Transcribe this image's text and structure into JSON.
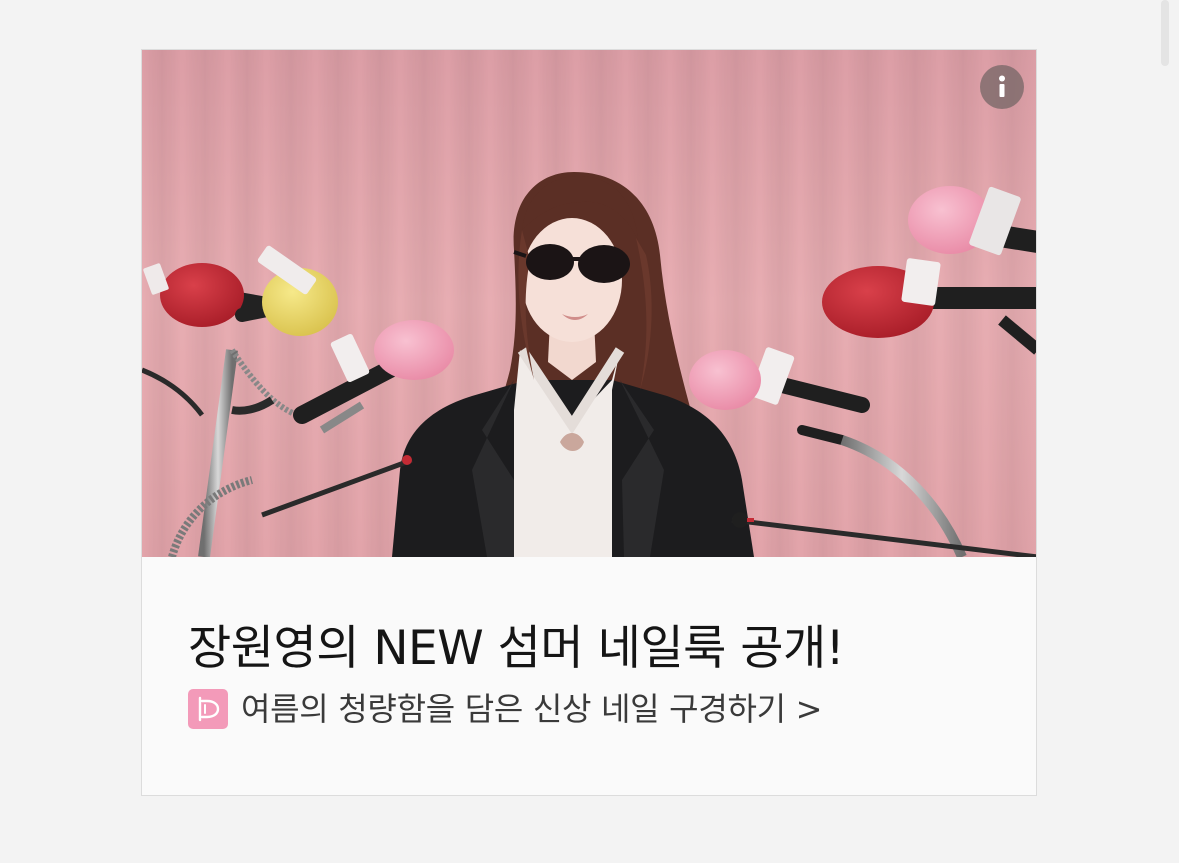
{
  "ad": {
    "title": "장원영의 NEW 섬머 네일룩 공개!",
    "subtitle": "여름의 청량함을 담은 신상 네일 구경하기 >",
    "info_icon": "info-icon",
    "brand_logo_icon": "brand-logo-d",
    "image": {
      "description": "woman-with-sunglasses-at-press-conference-microphones",
      "colors": {
        "curtain": "#e7adb2",
        "jacket": "#1c1c1e",
        "top": "#f1ece9",
        "hair": "#5b2f25",
        "mic_red": "#c42b35",
        "mic_pink": "#f2a1b8",
        "mic_yellow": "#eedb6a"
      }
    },
    "colors": {
      "info_bg": "#786868",
      "brand_logo": "#f39ab9",
      "title_text": "#151515",
      "subtitle_text": "#3a3a3a"
    }
  }
}
